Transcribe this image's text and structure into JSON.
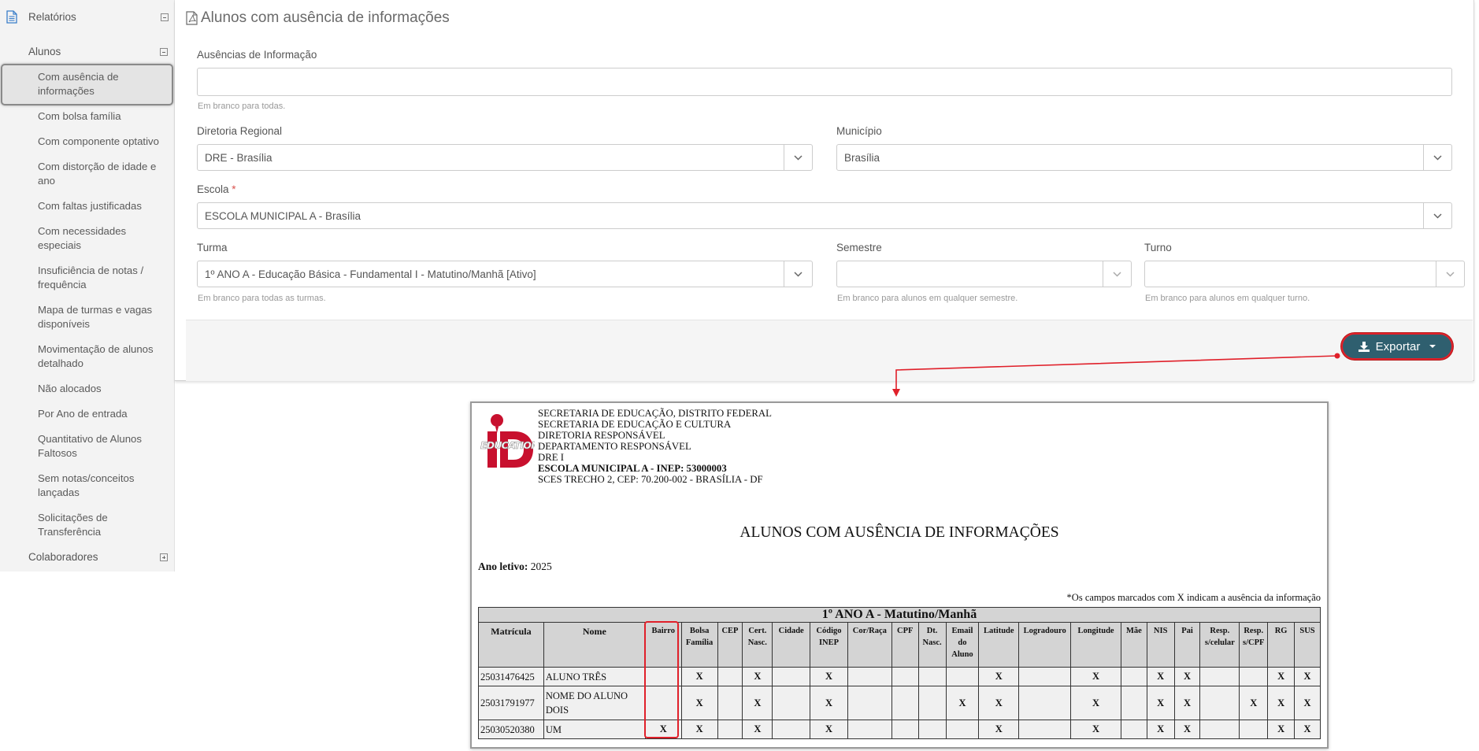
{
  "sidebar": {
    "root_label": "Relatórios",
    "group_label": "Alunos",
    "items": [
      "Com ausência de informações",
      "Com bolsa família",
      "Com componente optativo",
      "Com distorção de idade e ano",
      "Com faltas justificadas",
      "Com necessidades especiais",
      "Insuficiência de notas / frequência",
      "Mapa de turmas e vagas disponíveis",
      "Movimentação de alunos detalhado",
      "Não alocados",
      "Por Ano de entrada",
      "Quantitativo de Alunos Faltosos",
      "Sem notas/conceitos lançadas",
      "Solicitações de Transferência"
    ],
    "colab_label": "Colaboradores"
  },
  "form": {
    "title": "Alunos com ausência de informações",
    "ausencias_label": "Ausências de Informação",
    "ausencias_value": "",
    "ausencias_help": "Em branco para todas.",
    "dre_label": "Diretoria Regional",
    "dre_value": "DRE - Brasília",
    "municipio_label": "Município",
    "municipio_value": "Brasília",
    "escola_label": "Escola",
    "escola_required": "*",
    "escola_value": "ESCOLA MUNICIPAL A - Brasília",
    "turma_label": "Turma",
    "turma_value": "1º ANO A - Educação Básica - Fundamental I - Matutino/Manhã [Ativo]",
    "turma_help": "Em branco para todas as turmas.",
    "semestre_label": "Semestre",
    "semestre_value": "",
    "semestre_help": "Em branco para alunos em qualquer semestre.",
    "turno_label": "Turno",
    "turno_value": "",
    "turno_help": "Em branco para alunos em qualquer turno.",
    "export_label": "Exportar"
  },
  "report": {
    "header_lines": [
      "SECRETARIA DE EDUCAÇÃO, DISTRITO FEDERAL",
      "SECRETARIA DE EDUCAÇÃO E CULTURA",
      "DIRETORIA RESPONSÁVEL",
      "DEPARTAMENTO RESPONSÁVEL",
      "DRE I"
    ],
    "school_line": "ESCOLA MUNICIPAL A - INEP: 53000003",
    "address_line": "SCES TRECHO 2, CEP: 70.200-002 - BRASÍLIA - DF",
    "title": "ALUNOS COM AUSÊNCIA DE INFORMAÇÕES",
    "ano_label": "Ano letivo:",
    "ano_value": "2025",
    "note": "*Os campos marcados com X indicam a ausência da informação",
    "group_title": "1º ANO A - Matutino/Manhã",
    "columns": [
      "Matrícula",
      "Nome",
      "Bairro",
      "Bolsa Família",
      "CEP",
      "Cert. Nasc.",
      "Cidade",
      "Código INEP",
      "Cor/Raça",
      "CPF",
      "Dt. Nasc.",
      "Email do Aluno",
      "Latitude",
      "Logradouro",
      "Longitude",
      "Mãe",
      "NIS",
      "Pai",
      "Resp. s/celular",
      "Resp. s/CPF",
      "RG",
      "SUS"
    ],
    "rows": [
      {
        "matricula": "25031476425",
        "nome": "ALUNO TRÊS",
        "marks": [
          "",
          "X",
          "",
          "X",
          "",
          "X",
          "",
          "",
          "",
          "",
          "X",
          "",
          "X",
          "",
          "X",
          "X",
          "",
          "",
          "X",
          "X"
        ]
      },
      {
        "matricula": "25031791977",
        "nome": "NOME DO ALUNO DOIS",
        "marks": [
          "",
          "X",
          "",
          "X",
          "",
          "X",
          "",
          "",
          "",
          "X",
          "X",
          "",
          "X",
          "",
          "X",
          "X",
          "",
          "X",
          "X",
          "X"
        ]
      },
      {
        "matricula": "25030520380",
        "nome": "UM",
        "marks": [
          "X",
          "X",
          "",
          "X",
          "",
          "X",
          "",
          "",
          "",
          "",
          "X",
          "",
          "X",
          "",
          "X",
          "X",
          "",
          "",
          "X",
          "X"
        ]
      }
    ]
  }
}
